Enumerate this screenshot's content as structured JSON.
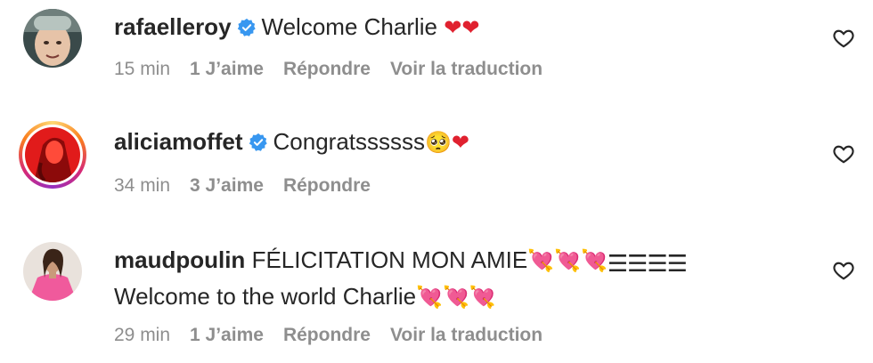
{
  "comments": [
    {
      "username": "rafaelleroy",
      "verified": true,
      "text": "Welcome Charlie",
      "emoji": "❤❤",
      "time": "15 min",
      "likes": "1 J’aime",
      "reply": "Répondre",
      "translate": "Voir la traduction"
    },
    {
      "username": "aliciamoffet",
      "verified": true,
      "text": "Congratssssss",
      "emoji": "🥺❤",
      "time": "34 min",
      "likes": "3 J’aime",
      "reply": "Répondre"
    },
    {
      "username": "maudpoulin",
      "verified": false,
      "text_line1": "FÉLICITATION MON AMIE",
      "emoji_line1": "💘💘💘",
      "bars": "☰☰☰☰",
      "text_line2": "Welcome to the world Charlie",
      "emoji_line2": "💘💘💘",
      "time": "29 min",
      "likes": "1 J’aime",
      "reply": "Répondre",
      "translate": "Voir la traduction"
    }
  ],
  "icons": {
    "verified": "verified-badge-icon",
    "like": "heart-outline-icon"
  },
  "colors": {
    "verified": "#3897f0",
    "meta": "#8e8e8e",
    "text": "#262626",
    "heart": "#e0212f"
  }
}
